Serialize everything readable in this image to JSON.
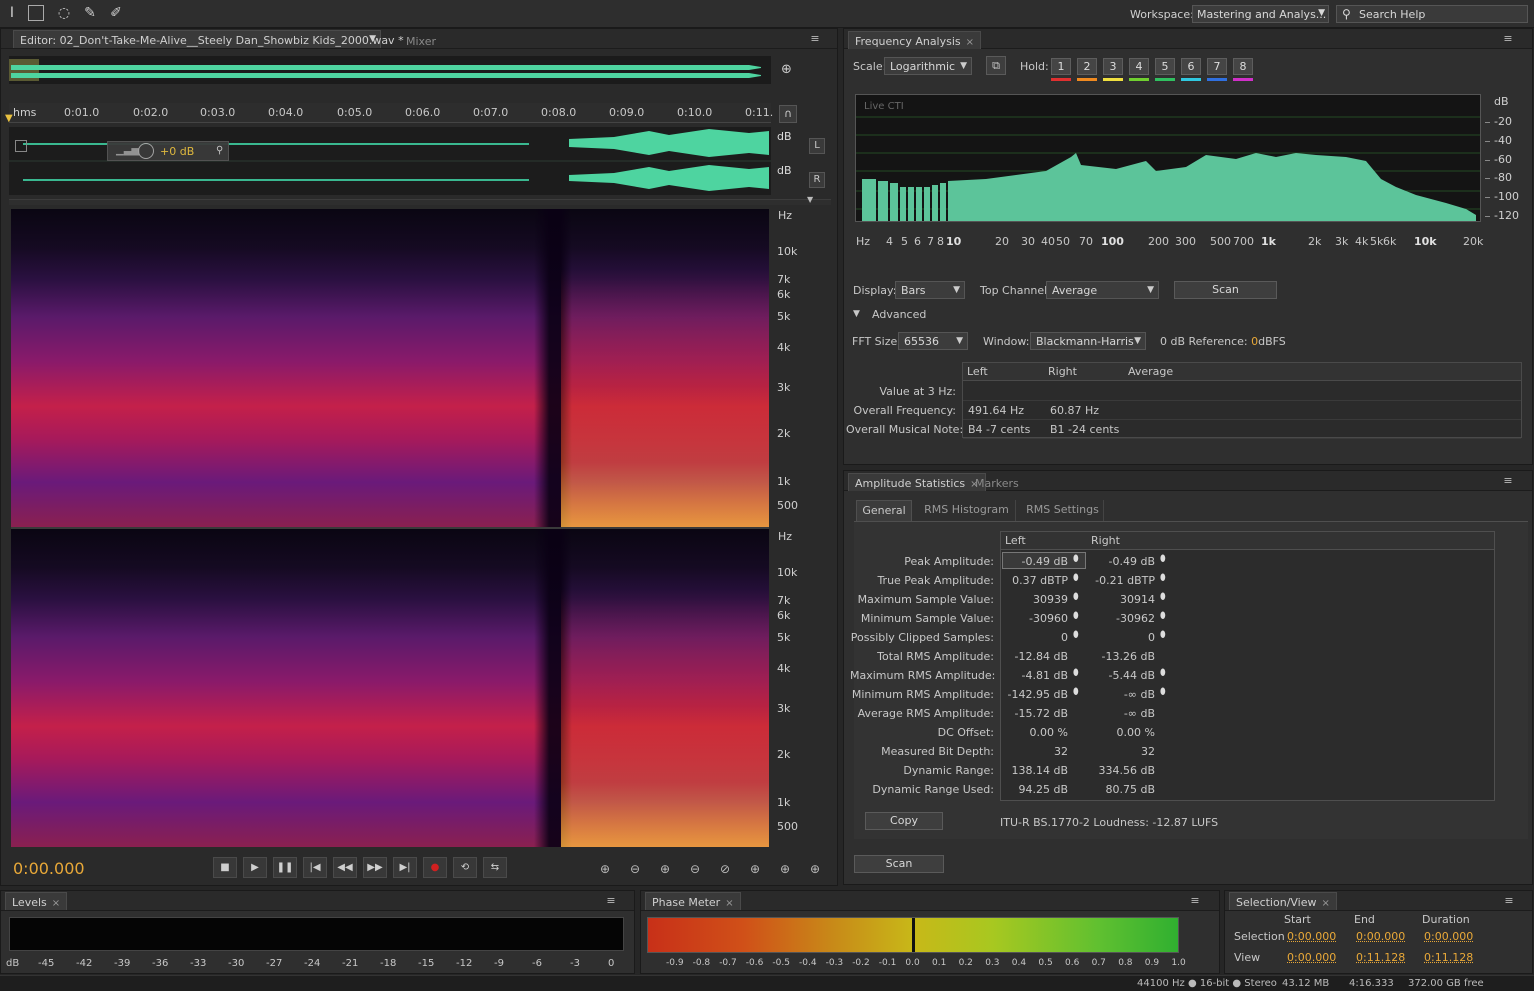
{
  "workspace": {
    "label": "Workspace:",
    "value": "Mastering and Analys...",
    "search_placeholder": "Search Help"
  },
  "editor": {
    "tab_label": "Editor: 02_Don't-Take-Me-Alive__Steely Dan_Showbiz Kids_2000.wav *",
    "mixer_tab": "Mixer",
    "ruler": {
      "unit": "hms",
      "ticks": [
        "0:01.0",
        "0:02.0",
        "0:03.0",
        "0:04.0",
        "0:05.0",
        "0:06.0",
        "0:07.0",
        "0:08.0",
        "0:09.0",
        "0:10.0",
        "0:11."
      ]
    },
    "volume_hud": "+0 dB",
    "channel_db_label": "dB",
    "channel_left": "L",
    "channel_right": "R",
    "spec_unit": "Hz",
    "freq_labels": [
      "10k",
      "7k",
      "6k",
      "5k",
      "4k",
      "3k",
      "2k",
      "1k",
      "500"
    ],
    "time_display": "0:00.000"
  },
  "freq_analysis": {
    "tab_label": "Frequency Analysis",
    "scale_label": "Scale:",
    "scale_value": "Logarithmic",
    "hold_label": "Hold:",
    "holds": [
      {
        "label": "1",
        "color": "#e03030"
      },
      {
        "label": "2",
        "color": "#f08a20"
      },
      {
        "label": "3",
        "color": "#f0e040"
      },
      {
        "label": "4",
        "color": "#70d030"
      },
      {
        "label": "5",
        "color": "#30c060"
      },
      {
        "label": "6",
        "color": "#30c8e0"
      },
      {
        "label": "7",
        "color": "#3070e0"
      },
      {
        "label": "8",
        "color": "#d030c8"
      }
    ],
    "graph_label": "Live CTI",
    "db_labels": [
      "dB",
      "-20",
      "-40",
      "-60",
      "-80",
      "-100",
      "-120"
    ],
    "x_unit": "Hz",
    "x_labels": [
      "4",
      "5",
      "6",
      "7",
      "8",
      "10",
      "20",
      "30",
      "40",
      "50",
      "70",
      "100",
      "200",
      "300",
      "500",
      "700",
      "1k",
      "2k",
      "3k",
      "4k",
      "5k",
      "6k",
      "10k",
      "20k"
    ],
    "display_label": "Display:",
    "display_value": "Bars",
    "top_channel_label": "Top Channel:",
    "top_channel_value": "Average",
    "scan_button": "Scan",
    "advanced_label": "Advanced",
    "fft_label": "FFT Size:",
    "fft_value": "65536",
    "window_label": "Window:",
    "window_value": "Blackmann-Harris",
    "ref_label_pre": "0 dB Reference:",
    "ref_value": "0",
    "ref_unit": "dBFS",
    "table_headers": [
      "Left",
      "Right",
      "Average"
    ],
    "rows": [
      {
        "label": "Value at 3 Hz:",
        "left": "",
        "right": ""
      },
      {
        "label": "Overall Frequency:",
        "left": "491.64 Hz",
        "right": "60.87 Hz"
      },
      {
        "label": "Overall Musical Note:",
        "left": "B4 -7 cents",
        "right": "B1 -24 cents"
      }
    ]
  },
  "amp_stats": {
    "tab_label": "Amplitude Statistics",
    "markers_tab": "Markers",
    "subtabs": [
      "General",
      "RMS Histogram",
      "RMS Settings"
    ],
    "headers": [
      "Left",
      "Right"
    ],
    "rows": [
      {
        "label": "Peak Amplitude:",
        "left": "-0.49 dB",
        "right": "-0.49 dB",
        "pin": true
      },
      {
        "label": "True Peak Amplitude:",
        "left": "0.37 dBTP",
        "right": "-0.21 dBTP",
        "pin": true
      },
      {
        "label": "Maximum Sample Value:",
        "left": "30939",
        "right": "30914",
        "pin": true
      },
      {
        "label": "Minimum Sample Value:",
        "left": "-30960",
        "right": "-30962",
        "pin": true
      },
      {
        "label": "Possibly Clipped Samples:",
        "left": "0",
        "right": "0",
        "pin": true
      },
      {
        "label": "Total RMS Amplitude:",
        "left": "-12.84 dB",
        "right": "-13.26 dB",
        "pin": false
      },
      {
        "label": "Maximum RMS Amplitude:",
        "left": "-4.81 dB",
        "right": "-5.44 dB",
        "pin": true
      },
      {
        "label": "Minimum RMS Amplitude:",
        "left": "-142.95 dB",
        "right": "-∞ dB",
        "pin": true
      },
      {
        "label": "Average RMS Amplitude:",
        "left": "-15.72 dB",
        "right": "-∞ dB",
        "pin": false
      },
      {
        "label": "DC Offset:",
        "left": "0.00 %",
        "right": "0.00 %",
        "pin": false
      },
      {
        "label": "Measured Bit Depth:",
        "left": "32",
        "right": "32",
        "pin": false
      },
      {
        "label": "Dynamic Range:",
        "left": "138.14 dB",
        "right": "334.56 dB",
        "pin": false
      },
      {
        "label": "Dynamic Range Used:",
        "left": "94.25 dB",
        "right": "80.75 dB",
        "pin": false
      }
    ],
    "copy_button": "Copy",
    "loudness": "ITU-R BS.1770-2 Loudness: -12.87 LUFS",
    "scan_button": "Scan"
  },
  "levels": {
    "tab_label": "Levels",
    "scale": [
      "dB",
      "-45",
      "-42",
      "-39",
      "-36",
      "-33",
      "-30",
      "-27",
      "-24",
      "-21",
      "-18",
      "-15",
      "-12",
      "-9",
      "-6",
      "-3",
      "0"
    ]
  },
  "phase_meter": {
    "tab_label": "Phase Meter",
    "scale": [
      "-0.9",
      "-0.8",
      "-0.7",
      "-0.6",
      "-0.5",
      "-0.4",
      "-0.3",
      "-0.2",
      "-0.1",
      "0.0",
      "0.1",
      "0.2",
      "0.3",
      "0.4",
      "0.5",
      "0.6",
      "0.7",
      "0.8",
      "0.9",
      "1.0"
    ]
  },
  "selection_view": {
    "tab_label": "Selection/View",
    "headers": [
      "Start",
      "End",
      "Duration"
    ],
    "selection_label": "Selection",
    "selection": [
      "0:00.000",
      "0:00.000",
      "0:00.000"
    ],
    "view_label": "View",
    "view": [
      "0:00.000",
      "0:11.128",
      "0:11.128"
    ]
  },
  "status": {
    "format": "44100 Hz ● 16-bit ● Stereo",
    "size": "43.12 MB",
    "duration": "4:16.333",
    "free": "372.00 GB free"
  }
}
